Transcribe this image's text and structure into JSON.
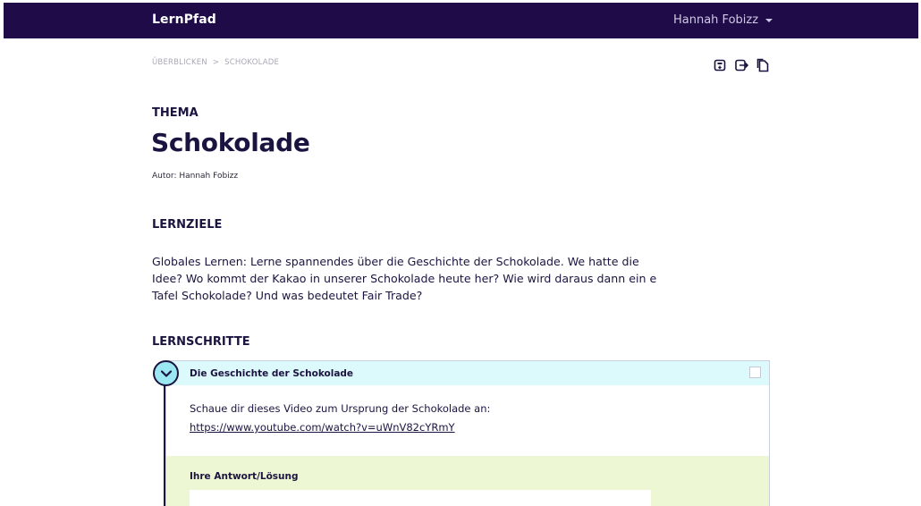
{
  "navbar": {
    "brand": "LernPfad",
    "user_name": "Hannah Fobizz"
  },
  "breadcrumb": {
    "items": [
      "ÜBERBLICKEN",
      "SCHOKOLADE"
    ],
    "separator": ">"
  },
  "toolbar": {
    "icons": [
      "save-icon",
      "export-icon",
      "copy-icon"
    ]
  },
  "header": {
    "eyebrow": "THEMA",
    "title": "Schokolade",
    "author": "Autor: Hannah Fobizz"
  },
  "goals": {
    "heading": "LERNZIELE",
    "text": "Globales Lernen: Lerne spannendes über die Geschichte der Schokolade. We hatte die Idee? Wo kommt der Kakao in unserer Schokolade heute her? Wie wird daraus dann ein e Tafel Schokolade? Und was bedeutet Fair Trade?"
  },
  "steps": {
    "heading": "LERNSCHRITTE",
    "items": [
      {
        "title": "Die Geschichte der Schokolade",
        "text": "Schaue dir dieses Video zum Ursprung der Schokolade an:",
        "link": "https://www.youtube.com/watch?v=uWnV82cYRmY",
        "answer_label": "Ihre Antwort/Lösung",
        "answer_value": ""
      }
    ]
  },
  "colors": {
    "navbar_bg": "#1e0b47",
    "text_primary": "#1b1440",
    "step_header_bg": "#dcf9fb",
    "step_toggle_bg": "#9be8f3",
    "answer_bg": "#eef7d3"
  }
}
